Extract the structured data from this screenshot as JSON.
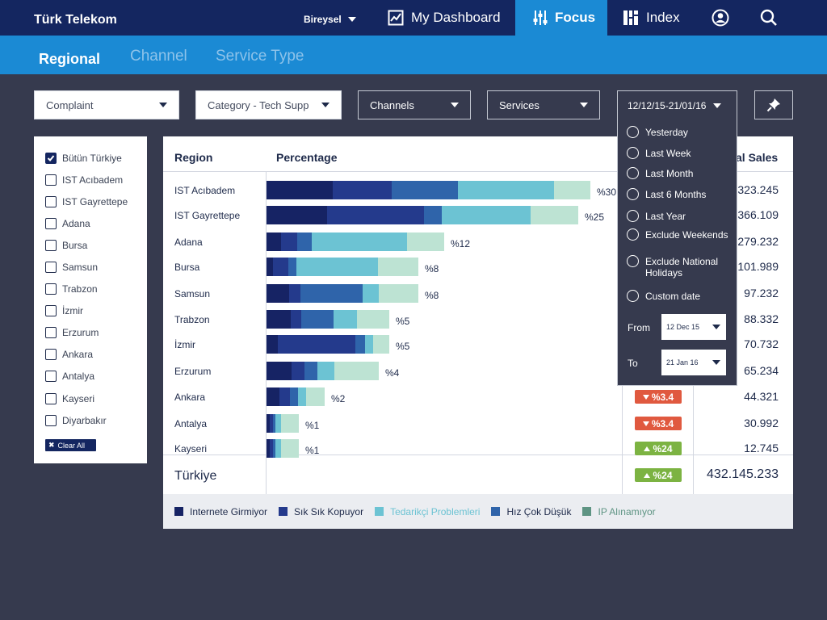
{
  "brand": "Türk Telekom",
  "segment": "Bireysel",
  "nav": {
    "dashboard": "My Dashboard",
    "focus": "Focus",
    "index": "Index"
  },
  "subnav": [
    "Regional",
    "Channel",
    "Service Type"
  ],
  "filters": {
    "complaint": "Complaint",
    "category": "Category - Tech Supp",
    "channels": "Channels",
    "services": "Services",
    "date": "12/12/15-21/01/16"
  },
  "region_list": [
    "Bütün Türkiye",
    "IST Acıbadem",
    "IST Gayrettepe",
    "Adana",
    "Bursa",
    "Samsun",
    "Trabzon",
    "İzmir",
    "Erzurum",
    "Ankara",
    "Antalya",
    "Kayseri",
    "Diyarbakır"
  ],
  "clear_all": "Clear All",
  "table": {
    "col_region": "Region",
    "col_percentage": "Percentage",
    "col_sales": "al Sales",
    "rows": [
      {
        "name": "IST Acıbadem",
        "pct": "%30",
        "sales": "323.245",
        "badge": "",
        "dir": ""
      },
      {
        "name": "IST Gayrettepe",
        "pct": "%25",
        "sales": "366.109",
        "badge": "",
        "dir": ""
      },
      {
        "name": "Adana",
        "pct": "%12",
        "sales": "279.232",
        "badge": "",
        "dir": ""
      },
      {
        "name": "Bursa",
        "pct": "%8",
        "sales": "101.989",
        "badge": "",
        "dir": ""
      },
      {
        "name": "Samsun",
        "pct": "%8",
        "sales": "97.232",
        "badge": "",
        "dir": ""
      },
      {
        "name": "Trabzon",
        "pct": "%5",
        "sales": "88.332",
        "badge": "",
        "dir": ""
      },
      {
        "name": "İzmir",
        "pct": "%5",
        "sales": "70.732",
        "badge": "",
        "dir": ""
      },
      {
        "name": "Erzurum",
        "pct": "%4",
        "sales": "65.234",
        "badge": "",
        "dir": ""
      },
      {
        "name": "Ankara",
        "pct": "%2",
        "sales": "44.321",
        "badge": "%3.4",
        "dir": "down"
      },
      {
        "name": "Antalya",
        "pct": "%1",
        "sales": "30.992",
        "badge": "%3.4",
        "dir": "down"
      },
      {
        "name": "Kayseri",
        "pct": "%1",
        "sales": "12.745",
        "badge": "%24",
        "dir": "up"
      }
    ],
    "total": {
      "name": "Türkiye",
      "badge": "%24",
      "sales": "432.145.233"
    }
  },
  "legend": [
    {
      "label": "Internete Girmiyor",
      "color": "#162364"
    },
    {
      "label": "Sık Sık Kopuyor",
      "color": "#243a8c"
    },
    {
      "label": "Tedarikçi Problemleri",
      "color": "#6cc3d3"
    },
    {
      "label": "Hız Çok Düşük",
      "color": "#2f64aa"
    },
    {
      "label": "IP Alınamıyor",
      "color": "#5e9483"
    }
  ],
  "date_options": [
    "Yesterday",
    "Last Week",
    "Last Month",
    "Last 6 Months",
    "Last Year",
    "Exclude Weekends",
    "Exclude National Holidays",
    "Custom date"
  ],
  "date_from_label": "From",
  "date_from": "12 Dec 15",
  "date_to_label": "To",
  "date_to": "21 Jan 16",
  "chart_data": {
    "type": "bar",
    "stacked": true,
    "segment_colors": [
      "#162364",
      "#243a8c",
      "#2f64aa",
      "#6cc3d3",
      "#bde3d3"
    ],
    "categories": [
      "IST Acıbadem",
      "IST Gayrettepe",
      "Adana",
      "Bursa",
      "Samsun",
      "Trabzon",
      "İzmir",
      "Erzurum",
      "Ankara",
      "Antalya",
      "Kayseri"
    ],
    "values": [
      30,
      25,
      12,
      8,
      8,
      5,
      5,
      4,
      2,
      1,
      1
    ],
    "segments": [
      [
        82,
        73,
        82,
        119,
        45
      ],
      [
        75,
        120,
        22,
        110,
        59
      ],
      [
        18,
        20,
        18,
        118,
        46
      ],
      [
        8,
        19,
        10,
        101,
        50
      ],
      [
        28,
        14,
        77,
        20,
        49
      ],
      [
        30,
        13,
        40,
        29,
        40
      ],
      [
        14,
        96,
        12,
        10,
        20
      ],
      [
        31,
        16,
        16,
        21,
        55
      ],
      [
        16,
        13,
        10,
        10,
        23
      ],
      [
        4,
        4,
        3,
        7,
        22
      ],
      [
        4,
        4,
        3,
        7,
        22
      ]
    ]
  }
}
